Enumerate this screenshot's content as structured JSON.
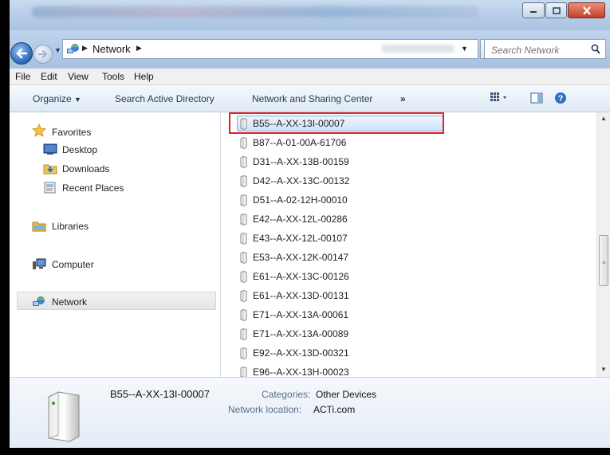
{
  "window": {
    "minimize_icon": "minimize-icon",
    "maximize_icon": "maximize-icon",
    "close_icon": "close-icon"
  },
  "address_bar": {
    "location": "Network",
    "search_placeholder": "Search Network"
  },
  "menu": {
    "file": "File",
    "edit": "Edit",
    "view": "View",
    "tools": "Tools",
    "help": "Help"
  },
  "toolbar": {
    "organize": "Organize",
    "search_ad": "Search Active Directory",
    "network_sharing": "Network and Sharing Center",
    "more": "»"
  },
  "nav": {
    "favorites": "Favorites",
    "desktop": "Desktop",
    "downloads": "Downloads",
    "recent_places": "Recent Places",
    "libraries": "Libraries",
    "computer": "Computer",
    "network": "Network"
  },
  "files": [
    {
      "name": "B55--A-XX-13I-00007",
      "selected": true
    },
    {
      "name": "B87--A-01-00A-61706",
      "selected": false
    },
    {
      "name": "D31--A-XX-13B-00159",
      "selected": false
    },
    {
      "name": "D42--A-XX-13C-00132",
      "selected": false
    },
    {
      "name": "D51--A-02-12H-00010",
      "selected": false
    },
    {
      "name": "E42--A-XX-12L-00286",
      "selected": false
    },
    {
      "name": "E43--A-XX-12L-00107",
      "selected": false
    },
    {
      "name": "E53--A-XX-12K-00147",
      "selected": false
    },
    {
      "name": "E61--A-XX-13C-00126",
      "selected": false
    },
    {
      "name": "E61--A-XX-13D-00131",
      "selected": false
    },
    {
      "name": "E71--A-XX-13A-00061",
      "selected": false
    },
    {
      "name": "E71--A-XX-13A-00089",
      "selected": false
    },
    {
      "name": "E92--A-XX-13D-00321",
      "selected": false
    },
    {
      "name": "E96--A-XX-13H-00023",
      "selected": false
    }
  ],
  "details": {
    "name": "B55--A-XX-13I-00007",
    "categories_label": "Categories:",
    "categories_value": "Other Devices",
    "location_label": "Network location:",
    "location_value": "ACTi.com"
  },
  "colors": {
    "highlight_border": "#e0202b",
    "selection_fill": "#cfe3fb",
    "title_bar": "#b9cfe8"
  }
}
